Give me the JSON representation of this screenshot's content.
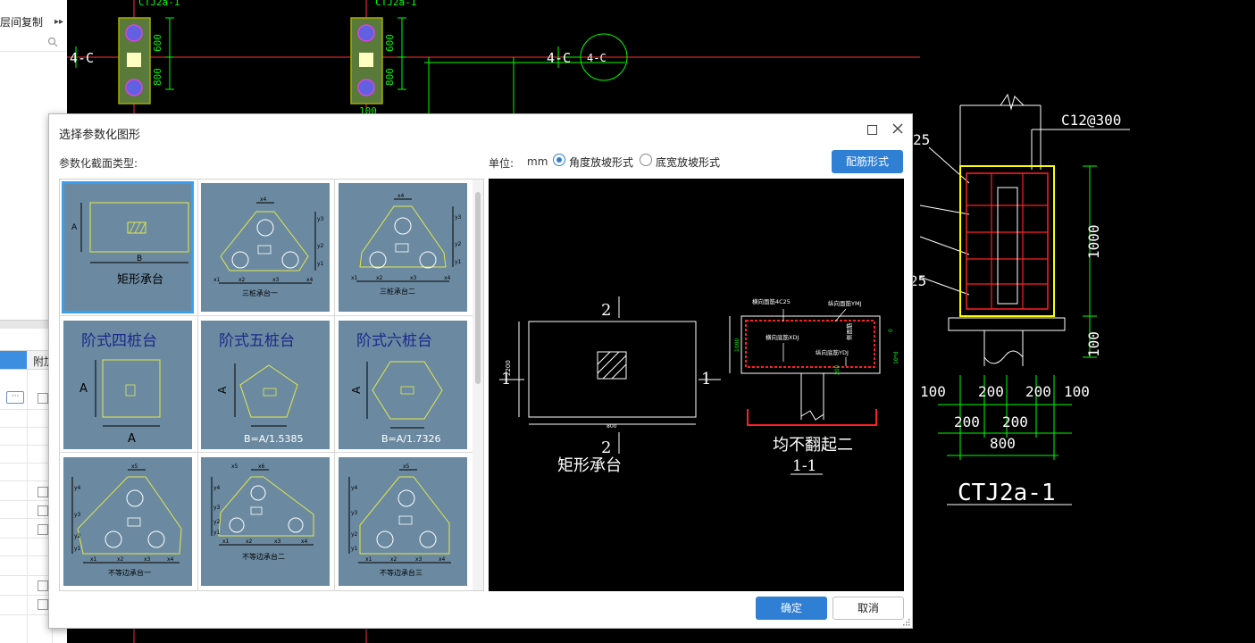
{
  "left_panel": {
    "title": "层间复制",
    "expand_glyph": "▸▸",
    "table_header": "附加",
    "more_button": "···"
  },
  "cad": {
    "axis_labels": [
      "4-C",
      "4-C",
      "4-C"
    ],
    "top_labels": [
      "CTJ2a-1",
      "CTJ2a-1"
    ],
    "dims_top": [
      "600",
      "800",
      "600",
      "800",
      "100"
    ],
    "section_label": "C12@300",
    "section_dims_h": [
      "100",
      "200",
      "200",
      "100",
      "200",
      "200",
      "800"
    ],
    "section_dims_v": [
      "1000",
      "100"
    ],
    "section_title": "CTJ2a-1",
    "side_marks": [
      "25",
      "25"
    ]
  },
  "dialog": {
    "title": "选择参数化图形",
    "section_type_label": "参数化截面类型:",
    "unit_label": "单位:",
    "unit_value": "mm",
    "radio_angle": "角度放坡形式",
    "radio_width": "底宽放坡形式",
    "rebar_button": "配筋形式",
    "ok_button": "确定",
    "cancel_button": "取消"
  },
  "thumbnails": [
    {
      "name": "矩形承台",
      "selected": true,
      "labels": [
        "A",
        "B"
      ]
    },
    {
      "name": "三桩承台一",
      "selected": false,
      "labels": [
        "x4",
        "x1",
        "x2",
        "x3",
        "x4",
        "y1",
        "y2",
        "y3"
      ]
    },
    {
      "name": "三桩承台二",
      "selected": false,
      "labels": [
        "x4",
        "x1",
        "x2",
        "x3",
        "x4",
        "y1",
        "y2",
        "y3"
      ]
    },
    {
      "name": "阶式四桩台",
      "selected": false,
      "labels": [
        "A",
        "A"
      ]
    },
    {
      "name": "阶式五桩台",
      "selected": false,
      "labels": [
        "A",
        "B=A/1.5385"
      ]
    },
    {
      "name": "阶式六桩台",
      "selected": false,
      "labels": [
        "A",
        "B=A/1.7326"
      ]
    },
    {
      "name": "不等边承台一",
      "selected": false,
      "labels": [
        "x5",
        "x1",
        "x2",
        "x3",
        "x4",
        "y1",
        "y2",
        "y3",
        "y4"
      ]
    },
    {
      "name": "不等边承台二",
      "selected": false,
      "labels": [
        "x5",
        "x6",
        "x1",
        "x2",
        "x3",
        "x4",
        "y1",
        "y2",
        "y3",
        "y4"
      ]
    },
    {
      "name": "不等边承台三",
      "selected": false,
      "labels": [
        "x5",
        "x1",
        "x2",
        "x3",
        "x4",
        "y1",
        "y2",
        "y3",
        "y4"
      ]
    }
  ],
  "preview": {
    "plan_title": "矩形承台",
    "section_mark_top": "2",
    "section_mark_bottom": "2",
    "section_mark_left": "1",
    "section_mark_right": "1",
    "plan_dim_v": "2200",
    "plan_dim_h": "800",
    "section_title": "1-1",
    "section_caption": "均不翻起二",
    "section_dim_v": "1000",
    "rebar_h_top": "横向面筋4C25",
    "rebar_v_top": "纵向面筋YMJ",
    "rebar_h_bottom": "横向底筋XDJ",
    "rebar_v_bottom": "纵向底筋YDJ",
    "side_rebar": "侧面筋",
    "dim_10d": "10*d",
    "dim_0": "0",
    "dim_200": "200"
  },
  "colors": {
    "accent": "#2f7fd5",
    "thumb_bg": "#6b8aa1",
    "thumb_line": "#e3e84a",
    "cad_green": "#00ff00",
    "cad_red": "#ff2020"
  }
}
